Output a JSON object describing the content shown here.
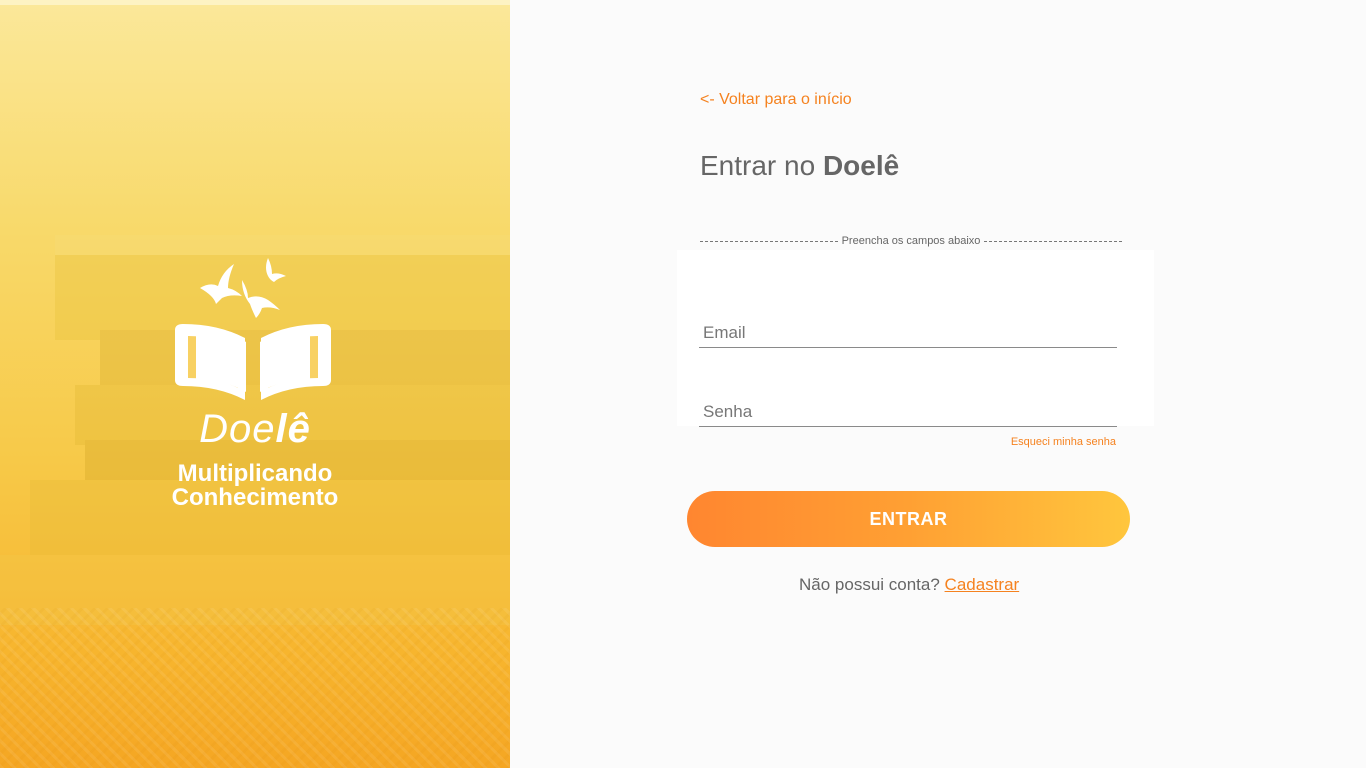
{
  "hero": {
    "brand_light": "Doe",
    "brand_bold": "lê",
    "tagline_line1": "Multiplicando",
    "tagline_line2": "Conhecimento",
    "logo_icon": "open-book-with-birds"
  },
  "form": {
    "back_link": "<- Voltar para o início",
    "title_prefix": "Entrar no ",
    "title_brand": "Doelê",
    "divider_text": "Preencha os campos abaixo",
    "email_placeholder": "Email",
    "password_placeholder": "Senha",
    "forgot_password": "Esqueci minha senha",
    "submit_label": "ENTRAR",
    "signup_prompt": "Não possui conta? ",
    "signup_link": "Cadastrar"
  },
  "colors": {
    "accent": "#f5821f",
    "button_gradient_start": "#ff8630",
    "button_gradient_end": "#ffc63d",
    "hero_yellow": "#f7c948",
    "text_gray": "#666666"
  }
}
